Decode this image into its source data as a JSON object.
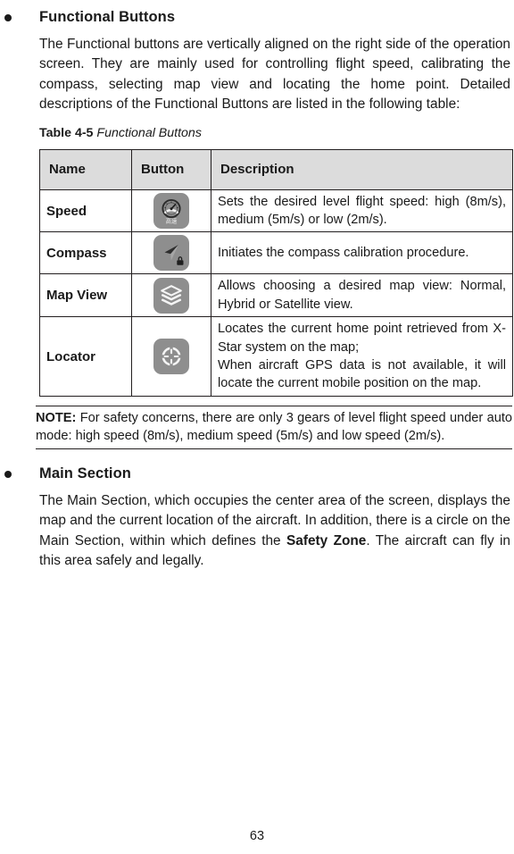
{
  "page": {
    "number": "63"
  },
  "sections": [
    {
      "heading": "Functional Buttons",
      "paragraph": "The Functional buttons are vertically aligned on the right side of the operation screen. They are mainly used for controlling flight speed, calibrating the compass, selecting map view and locating the home point. Detailed descriptions of the Functional Buttons are listed in the following table:"
    },
    {
      "heading": "Main Section",
      "paragraph_part1": "The Main Section, which occupies the center area of the screen, displays the map and the current location of the aircraft. In addition, there is a circle on the Main Section, within which defines the ",
      "paragraph_emphasis": "Safety Zone",
      "paragraph_part2": ". The aircraft can fly in this area safely and legally."
    }
  ],
  "table": {
    "caption_label": "Table 4-5",
    "caption_title": "Functional Buttons",
    "columns": [
      "Name",
      "Button",
      "Description"
    ],
    "rows": [
      {
        "name": "Speed",
        "icon": "speedometer-icon",
        "icon_caption": "高速",
        "description_lines": [
          "Sets the desired level flight speed: high (8m/s), medium (5m/s) or low (2m/s)."
        ]
      },
      {
        "name": "Compass",
        "icon": "compass-arrow-lock-icon",
        "icon_caption": "",
        "description_lines": [
          "Initiates the compass calibration procedure."
        ]
      },
      {
        "name": "Map View",
        "icon": "map-layers-icon",
        "icon_caption": "",
        "description_lines": [
          "Allows choosing a desired map view: Normal, Hybrid or Satellite view."
        ]
      },
      {
        "name": "Locator",
        "icon": "crosshair-target-icon",
        "icon_caption": "",
        "description_lines": [
          "Locates the current home point retrieved from X-Star system on the map;",
          "When aircraft GPS data is not available, it will locate the current mobile position on the map."
        ]
      }
    ]
  },
  "note": {
    "label": "NOTE:",
    "text": " For safety concerns, there are only 3 gears of level flight speed under auto mode: high speed (8m/s), medium speed (5m/s) and low speed (2m/s)."
  },
  "colors": {
    "icon_background": "#8e8e8e",
    "table_header_background": "#dcdcdc",
    "rule": "#231f20",
    "text": "#1a1a1a"
  }
}
